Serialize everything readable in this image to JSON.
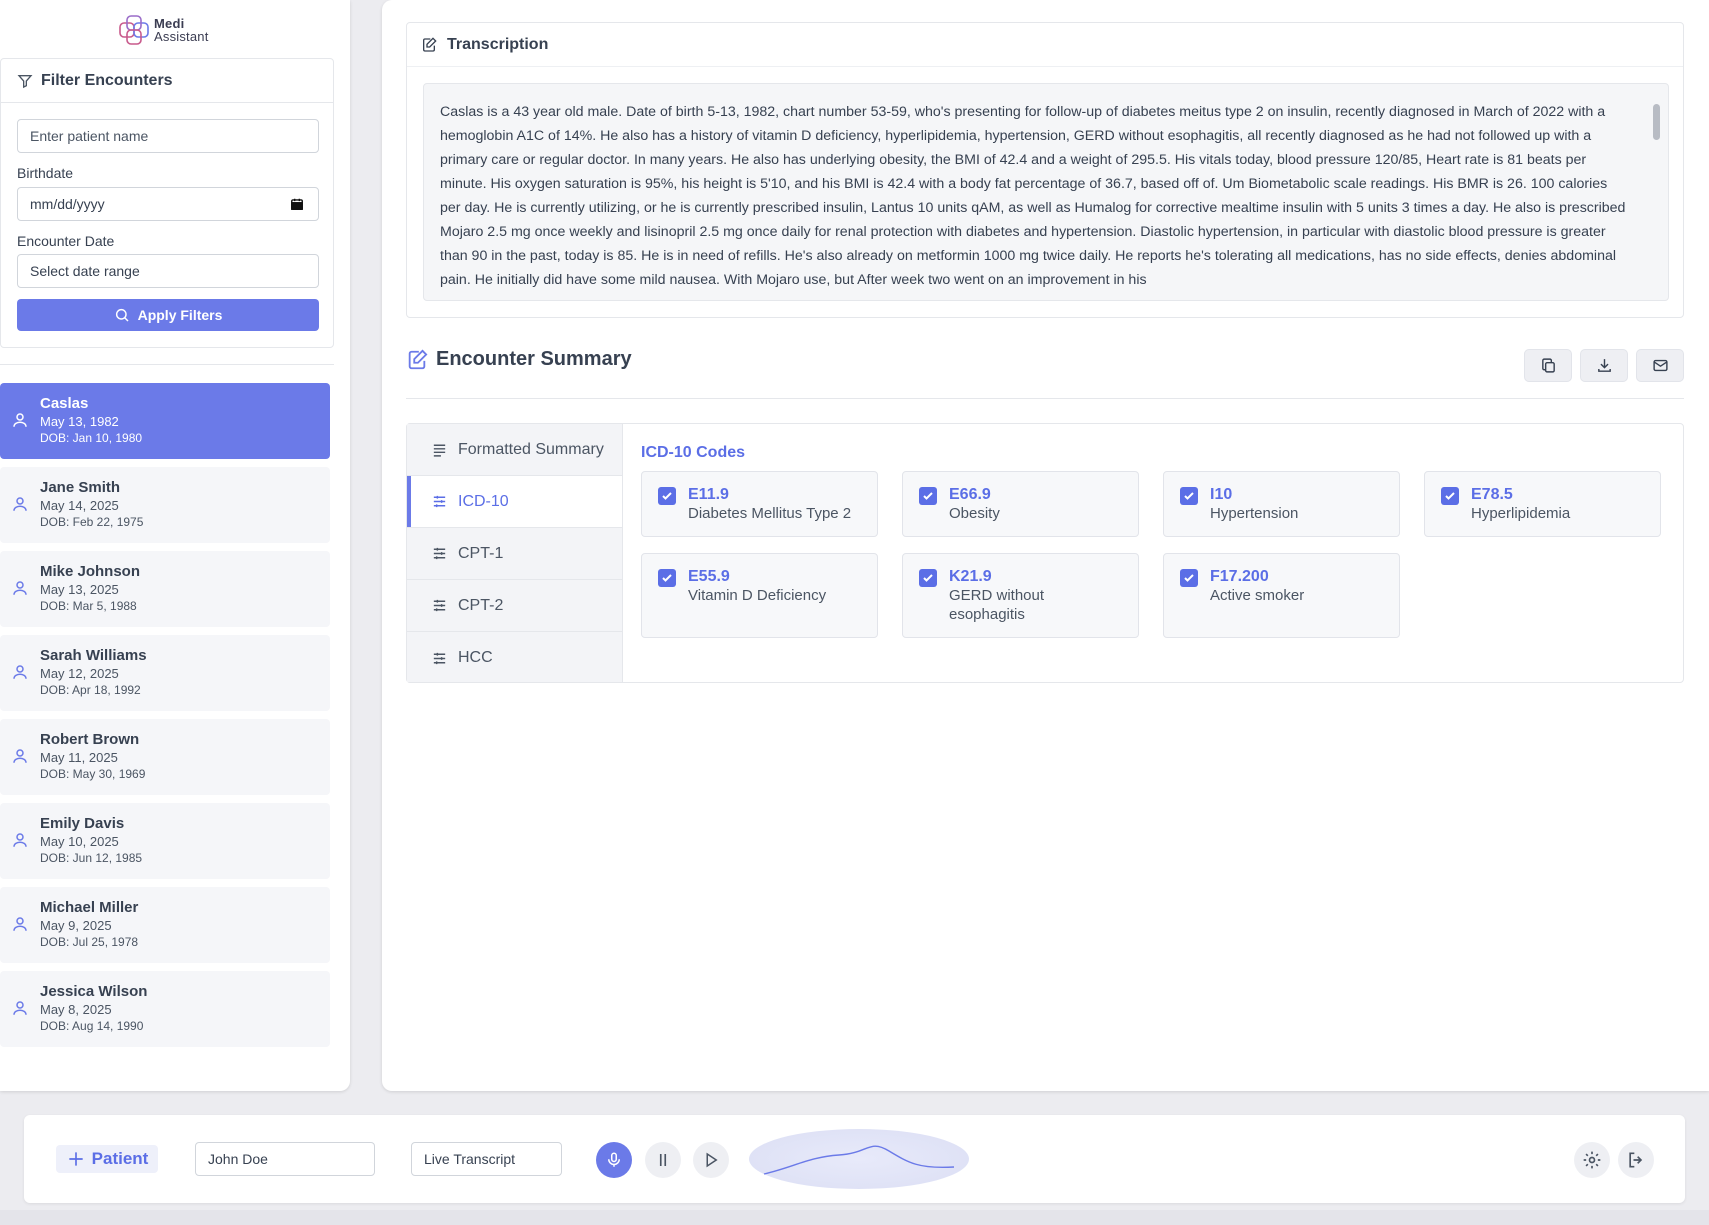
{
  "brand": {
    "line1": "Medi",
    "line2": "Assistant"
  },
  "filter": {
    "title": "Filter Encounters",
    "patient_placeholder": "Enter patient name",
    "birthdate_label": "Birthdate",
    "birthdate_placeholder": "mm/dd/yyyy",
    "encounter_label": "Encounter Date",
    "encounter_placeholder": "Select date range",
    "apply_label": "Apply Filters"
  },
  "patients": [
    {
      "name": "Caslas",
      "date": "May 13, 1982",
      "dob": "DOB: Jan 10, 1980"
    },
    {
      "name": "Jane Smith",
      "date": "May 14, 2025",
      "dob": "DOB: Feb 22, 1975"
    },
    {
      "name": "Mike Johnson",
      "date": "May 13, 2025",
      "dob": "DOB: Mar 5, 1988"
    },
    {
      "name": "Sarah Williams",
      "date": "May 12, 2025",
      "dob": "DOB: Apr 18, 1992"
    },
    {
      "name": "Robert Brown",
      "date": "May 11, 2025",
      "dob": "DOB: May 30, 1969"
    },
    {
      "name": "Emily Davis",
      "date": "May 10, 2025",
      "dob": "DOB: Jun 12, 1985"
    },
    {
      "name": "Michael Miller",
      "date": "May 9, 2025",
      "dob": "DOB: Jul 25, 1978"
    },
    {
      "name": "Jessica Wilson",
      "date": "May 8, 2025",
      "dob": "DOB: Aug 14, 1990"
    }
  ],
  "transcription": {
    "title": "Transcription",
    "text": "Caslas is a 43 year old male. Date of birth 5-13, 1982, chart number 53-59, who's presenting for follow-up of diabetes meitus type 2 on insulin, recently diagnosed in March of 2022 with a hemoglobin A1C of 14%. He also has a history of vitamin D deficiency, hyperlipidemia, hypertension, GERD without esophagitis, all recently diagnosed as he had not followed up with a primary care or regular doctor. In many years. He also has underlying obesity, the BMI of 42.4 and a weight of 295.5. His vitals today, blood pressure 120/85, Heart rate is 81 beats per minute. His oxygen saturation is 95%, his height is 5'10, and his BMI is 42.4 with a body fat percentage of 36.7, based off of. Um Biometabolic scale readings. His BMR is 26. 100 calories per day. He is currently utilizing, or he is currently prescribed insulin, Lantus 10 units qAM, as well as Humalog for corrective mealtime insulin with 5 units 3 times a day. He also is prescribed Mojaro 2.5 mg once weekly and lisinopril 2.5 mg once daily for renal protection with diabetes and hypertension. Diastolic hypertension, in particular with diastolic blood pressure is greater than 90 in the past, today is 85. He is in need of refills. He's also already on metformin 1000 mg twice daily. He reports he's tolerating all medications, has no side effects, denies abdominal pain. He initially did have some mild nausea. With Mojaro use, but After week two went on an improvement in his"
  },
  "summary": {
    "title": "Encounter Summary",
    "tabs": [
      "Formatted Summary",
      "ICD-10",
      "CPT-1",
      "CPT-2",
      "HCC"
    ],
    "codes_title": "ICD-10 Codes",
    "codes": [
      {
        "code": "E11.9",
        "desc": "Diabetes Mellitus Type 2"
      },
      {
        "code": "E66.9",
        "desc": "Obesity"
      },
      {
        "code": "I10",
        "desc": "Hypertension"
      },
      {
        "code": "E78.5",
        "desc": "Hyperlipidemia"
      },
      {
        "code": "E55.9",
        "desc": "Vitamin D Deficiency"
      },
      {
        "code": "K21.9",
        "desc": "GERD without esophagitis"
      },
      {
        "code": "F17.200",
        "desc": "Active smoker"
      }
    ]
  },
  "bottom": {
    "add_patient": "Patient",
    "patient_value": "John Doe",
    "mode_value": "Live Transcript"
  },
  "colors": {
    "accent": "#6b7ae8",
    "accent_text": "#5b6ee6"
  }
}
